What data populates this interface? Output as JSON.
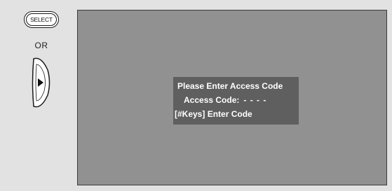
{
  "remote": {
    "select_label": "SELECT",
    "or_label": "OR",
    "right_key_icon": "right-arrow-key-icon"
  },
  "osd": {
    "title": "Please Enter Access Code",
    "code_label": "Access Code:",
    "code_value": "- - - -",
    "keys_hint": "[#Keys] Enter Code"
  },
  "colors": {
    "background": "#e2e2e2",
    "screen": "#919191",
    "osd_box": "#5f5f5f",
    "osd_text": "#ffffff"
  }
}
